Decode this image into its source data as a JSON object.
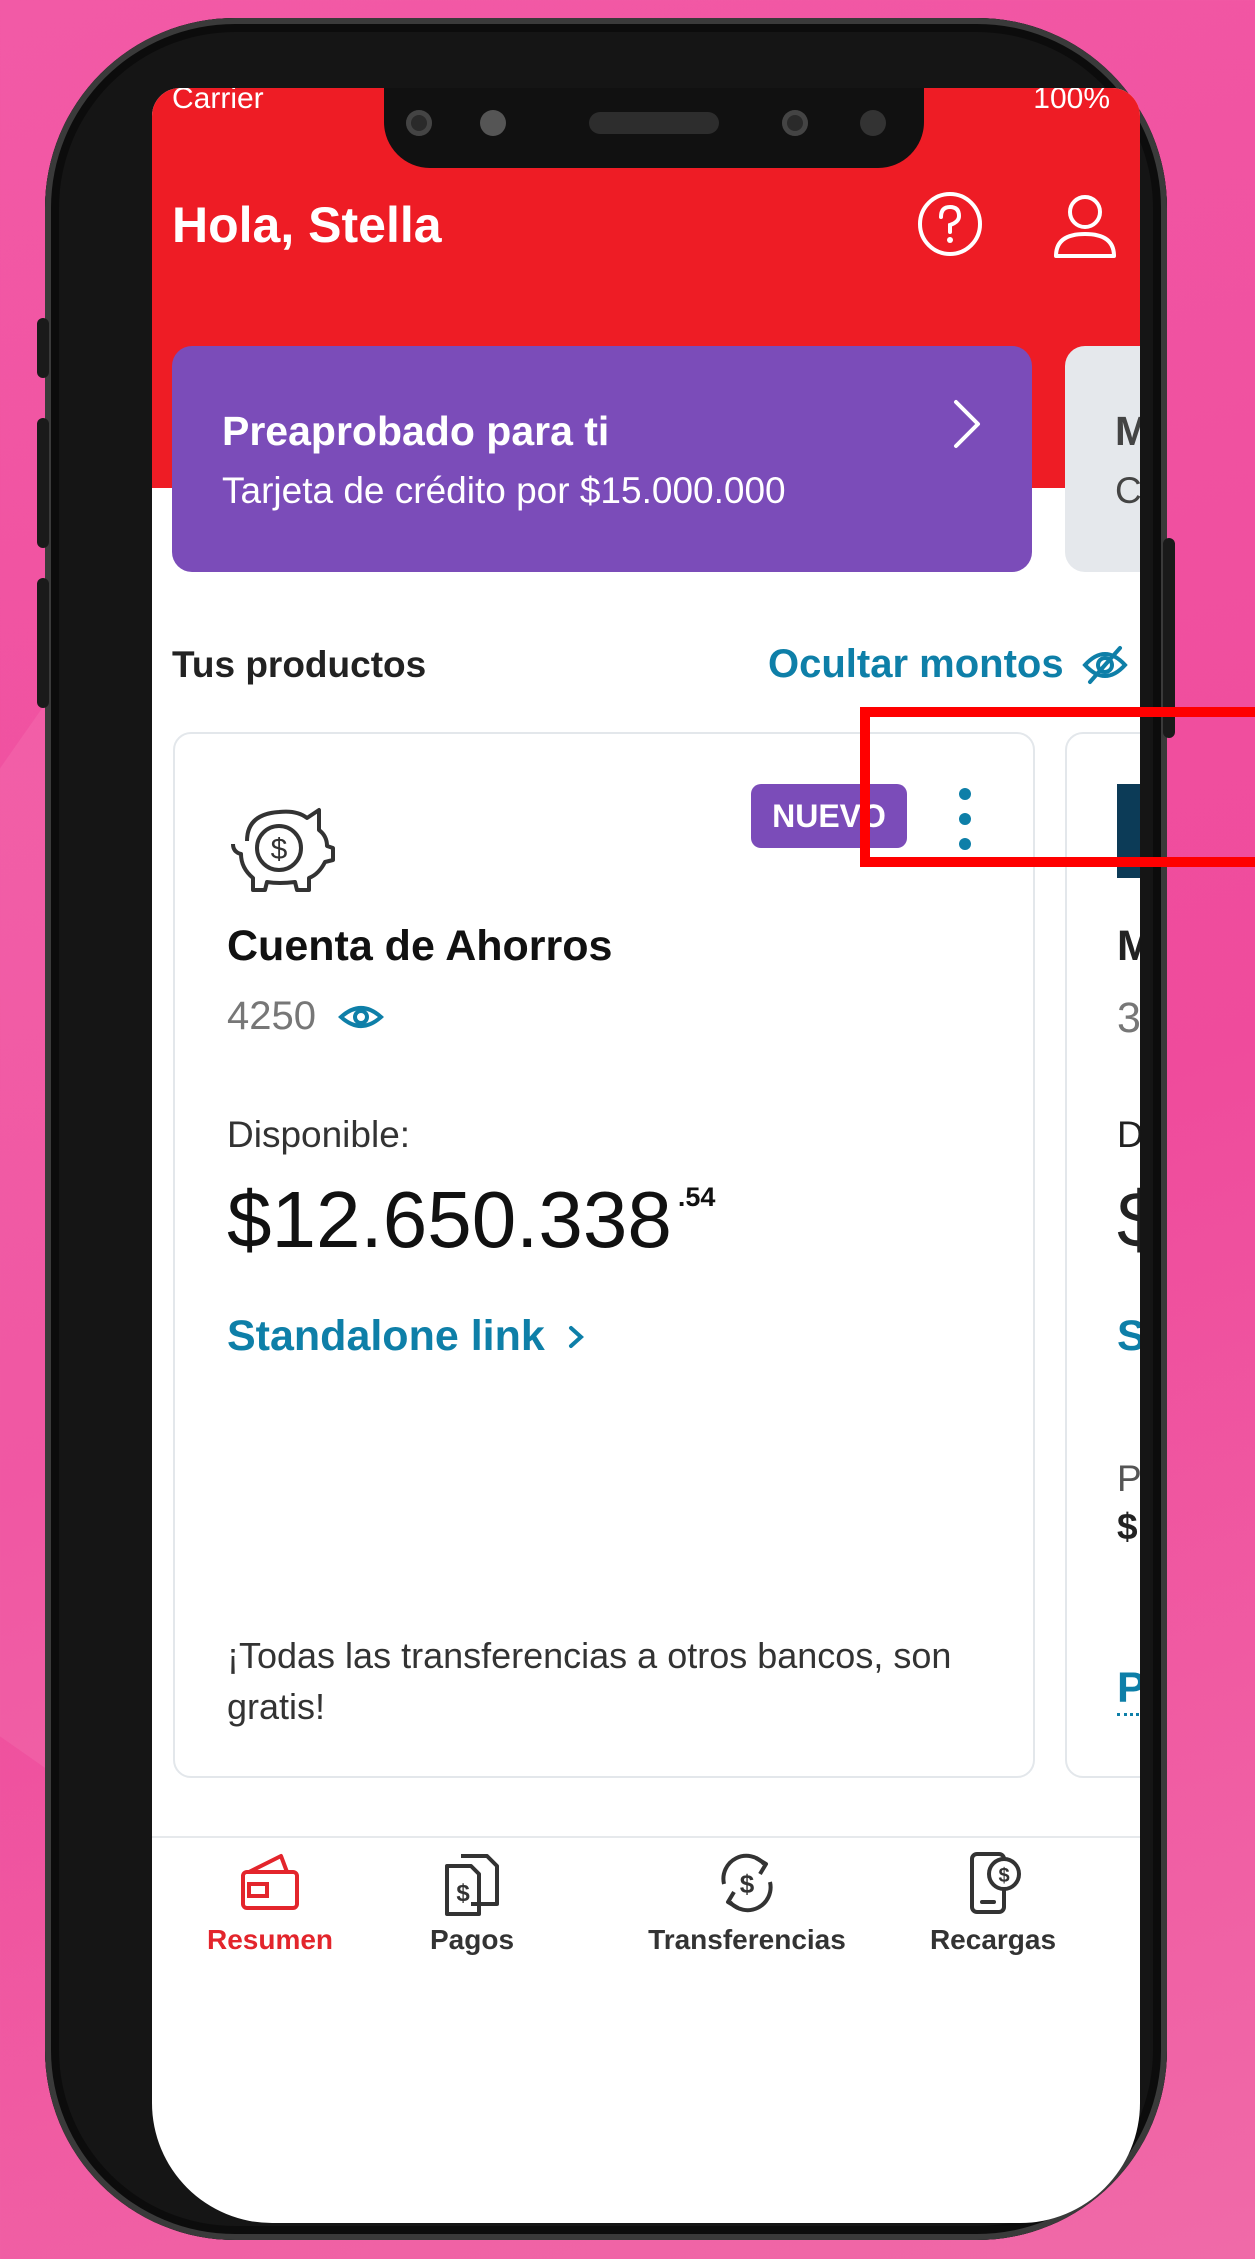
{
  "status_bar": {
    "carrier": "Carrier",
    "battery": "100%"
  },
  "header": {
    "greeting": "Hola, Stella"
  },
  "promo_card": {
    "title": "Preaprobado para ti",
    "subtitle": "Tarjeta de crédito por $15.000.000"
  },
  "promo_card_next": {
    "title_partial": "M",
    "subtitle_partial": "C"
  },
  "products_section": {
    "title": "Tus productos",
    "hide_amounts_label": "Ocultar montos"
  },
  "account_card": {
    "badge": "NUEVO",
    "name": "Cuenta de Ahorros",
    "number": "4250",
    "available_label": "Disponible:",
    "balance_main": "$12.650.338",
    "balance_cents": ".54",
    "link_label": "Standalone link",
    "footer_note": "¡Todas las transferencias a otros bancos, son gratis!"
  },
  "account_card_next": {
    "line1": "M",
    "line2": "3",
    "line3": "D",
    "line4": "$",
    "line5": "S",
    "line6": "P",
    "line7": "$",
    "line8": "P"
  },
  "colors": {
    "brand_red": "#ee1c25",
    "purple": "#7b4cb9",
    "link_blue": "#0e7fa8",
    "highlight_red": "#ff0000"
  },
  "tabbar": {
    "tabs": [
      {
        "label": "Resumen",
        "icon": "wallet-icon",
        "active": true
      },
      {
        "label": "Pagos",
        "icon": "bill-payment-icon",
        "active": false
      },
      {
        "label": "Transferencias",
        "icon": "transfer-icon",
        "active": false
      },
      {
        "label": "Recargas",
        "icon": "phone-recharge-icon",
        "active": false
      }
    ]
  }
}
